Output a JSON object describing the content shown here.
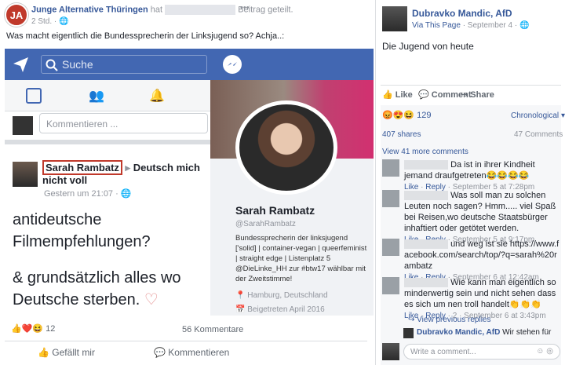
{
  "post": {
    "page_name": "Junge Alternative Thüringen",
    "has_label": "hat",
    "post_label": "Beitrag geteilt.",
    "time": "2 Std.",
    "more": "•••",
    "caption": "Was macht eigentlich die Bundessprecherin der Linksjugend so? Achja..:"
  },
  "screenshot": {
    "search_placeholder": "Suche",
    "comment_placeholder": "Kommentieren ...",
    "author": "Sarah Rambatz",
    "arrow": "▸",
    "target": "Deutsch mich nicht voll",
    "time": "Gestern um 21:07 · ",
    "body1": "antideutsche Filmempfehlungen?",
    "body2": "& grundsätzlich alles wo Deutsche sterben.",
    "reactions_count": "12",
    "comments_count": "56 Kommentare",
    "like_label": "Gefällt mir",
    "comment_label": "Kommentieren",
    "profile": {
      "name": "Sarah Rambatz",
      "handle": "@SarahRambatz",
      "bio": "Bundessprecherin der linksjugend ['solid] | container-vegan | queerfeminist | straight edge | Listenplatz 5 @DieLinke_HH zur #btw17 wählbar mit der Zweitstimme!",
      "location": "Hamburg, Deutschland",
      "joined": "Beigetreten April 2016"
    }
  },
  "side": {
    "author": "Dubravko Mandic, AfD",
    "via": "Via This Page",
    "date": "· September 4 ·",
    "text": "Die Jugend von heute",
    "actions": {
      "like": "Like",
      "comment": "Comment",
      "share": "Share"
    },
    "reaction_count": "129",
    "sort": "Chronological",
    "shares": "407 shares",
    "comments_total": "47 Comments",
    "view_more": "View 41 more comments",
    "comments": [
      {
        "text": "Da ist in ihrer Kindheit jemand draufgetreten😂😂😂😂",
        "meta": "· September 5 at 7:28pm"
      },
      {
        "text": "Was soll man zu solchen Leuten noch sagen? Hmm..... viel Spaß bei Reisen,wo deutsche Staatsbürger inhaftiert oder getötet werden.",
        "meta": "· September 5 at 9:17pm"
      },
      {
        "text": "und weg ist sie https://www.facebook.com/search/top/?q=sarah%20rambatz",
        "meta": "· September 6 at 12:42am"
      },
      {
        "text": "Wie kann man eigentlich so minderwertig sein und nicht sehen dass es sich um nen troll handelt👏👏👏",
        "meta": "· 2 · September 6 at 3:43pm"
      }
    ],
    "like_label": "Like",
    "reply_label": "Reply",
    "view_replies": "View previous replies",
    "reply_author": "Dubravko Mandic, AfD",
    "reply_text": "Wir stehen für",
    "write_placeholder": "Write a comment..."
  },
  "colors": {
    "fb_blue": "#4267b2",
    "link": "#365899",
    "highlight_box": "#c0392b"
  }
}
